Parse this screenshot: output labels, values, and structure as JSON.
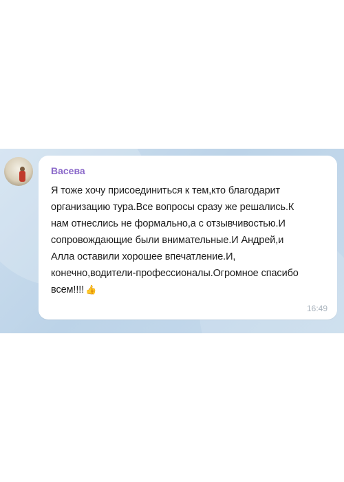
{
  "message": {
    "sender": "Васева",
    "lines": [
      "Я тоже хочу присоединиться к тем,кто благодарит",
      "организацию тура.Все вопросы сразу же решались.К",
      "нам отнеслись не формально,а с отзывчивостью.И",
      "сопровождающие были внимательные.И Андрей,и",
      "Алла оставили хорошее впечатление.И,",
      "конечно,водители-профессионалы.Огромное спасибо",
      "всем!!!!"
    ],
    "emoji": "👍",
    "time": "16:49"
  },
  "colors": {
    "sender_name": "#8a68c9",
    "chat_background": "#c7dbec",
    "bubble": "#ffffff",
    "timestamp": "#a9b3bd"
  },
  "icons": {
    "avatar": "sender-avatar",
    "reaction": "thumbs-up-emoji"
  }
}
